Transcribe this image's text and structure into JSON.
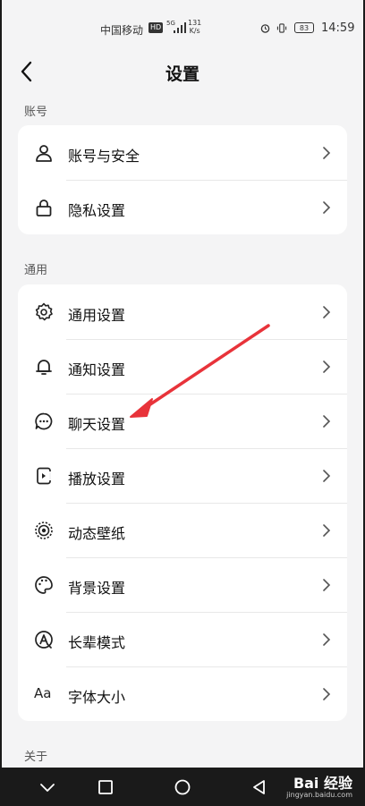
{
  "status": {
    "carrier": "中国移动",
    "hd": "HD",
    "signal_type": "5G",
    "speed_value": "131",
    "speed_unit": "K/s",
    "battery": "83",
    "time": "14:59"
  },
  "header": {
    "title": "设置"
  },
  "sections": {
    "account": "账号",
    "general": "通用",
    "about": "关于"
  },
  "account_items": [
    {
      "label": "账号与安全",
      "icon": "person-icon"
    },
    {
      "label": "隐私设置",
      "icon": "lock-icon"
    }
  ],
  "general_items": [
    {
      "label": "通用设置",
      "icon": "gear-icon"
    },
    {
      "label": "通知设置",
      "icon": "bell-icon"
    },
    {
      "label": "聊天设置",
      "icon": "chat-bubble-icon"
    },
    {
      "label": "播放设置",
      "icon": "playback-icon"
    },
    {
      "label": "动态壁纸",
      "icon": "live-wallpaper-icon"
    },
    {
      "label": "背景设置",
      "icon": "palette-icon"
    },
    {
      "label": "长辈模式",
      "icon": "elder-mode-icon"
    },
    {
      "label": "字体大小",
      "icon": "font-size-icon",
      "glyph": "Aa"
    }
  ],
  "watermark": {
    "logo": "Bai 经验",
    "url": "jingyan.baidu.com"
  },
  "colors": {
    "annotation_arrow": "#e8333a",
    "card": "#ffffff",
    "background": "#f4f4f5"
  }
}
